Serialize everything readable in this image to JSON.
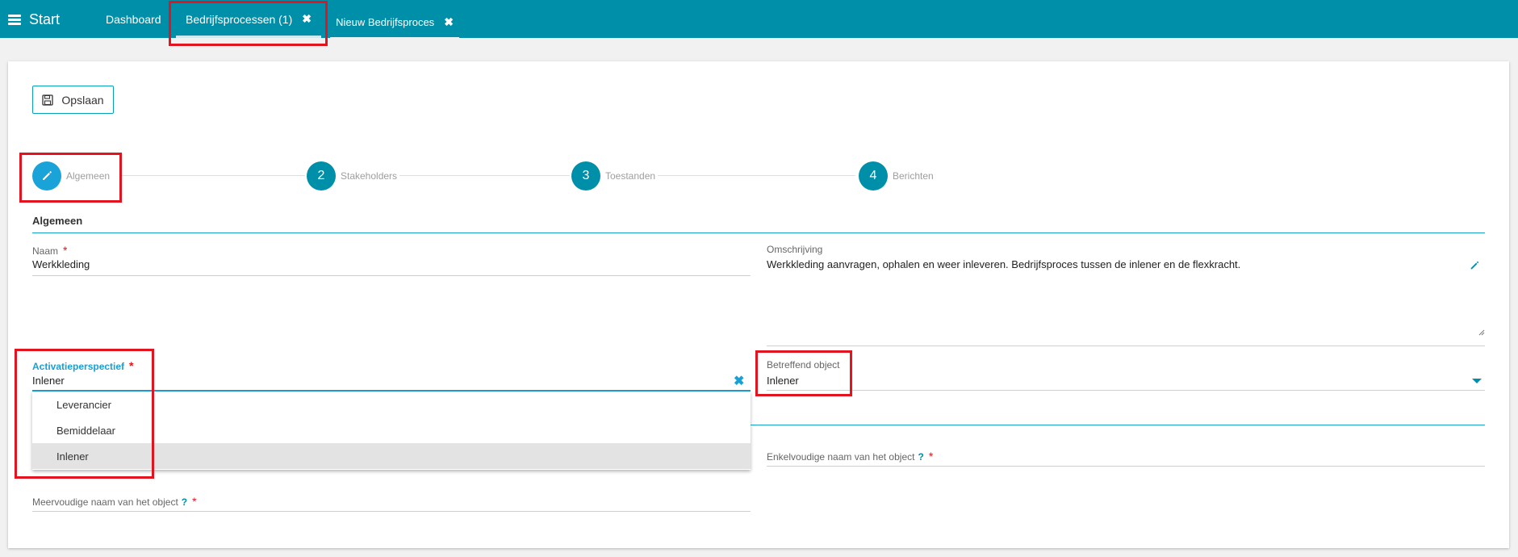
{
  "topbar": {
    "start_label": "Start",
    "tabs": [
      {
        "label": "Dashboard"
      },
      {
        "label": "Bedrijfsprocessen (1)",
        "close": "✖"
      },
      {
        "label": "Nieuw Bedrijfsproces",
        "close": "✖"
      }
    ]
  },
  "toolbar": {
    "save_label": "Opslaan"
  },
  "stepper": {
    "steps": [
      {
        "number": "",
        "label": "Algemeen"
      },
      {
        "number": "2",
        "label": "Stakeholders"
      },
      {
        "number": "3",
        "label": "Toestanden"
      },
      {
        "number": "4",
        "label": "Berichten"
      }
    ]
  },
  "section": {
    "title": "Algemeen"
  },
  "form": {
    "naam": {
      "label": "Naam",
      "value": "Werkkleding",
      "required": "*"
    },
    "omschrijving": {
      "label": "Omschrijving",
      "value": "Werkkleding aanvragen, ophalen en weer inleveren. Bedrijfsproces tussen de inlener en de flexkracht."
    },
    "activatieperspectief": {
      "label": "Activatieperspectief",
      "required": "*",
      "value": "Inlener",
      "options": [
        "Leverancier",
        "Bemiddelaar",
        "Inlener"
      ],
      "selected_index": 2
    },
    "betreffend_object": {
      "label": "Betreffend object",
      "value": "Inlener"
    },
    "enkelvoudige_naam": {
      "label": "Enkelvoudige naam van het object",
      "help": "?",
      "required": "*"
    },
    "meervoudige_naam": {
      "label": "Meervoudige naam van het object",
      "help": "?",
      "required": "*"
    }
  },
  "colors": {
    "primary": "#008fa8",
    "accent": "#1aa3d8",
    "required": "#e1141f",
    "highlight": "#e1141f"
  }
}
